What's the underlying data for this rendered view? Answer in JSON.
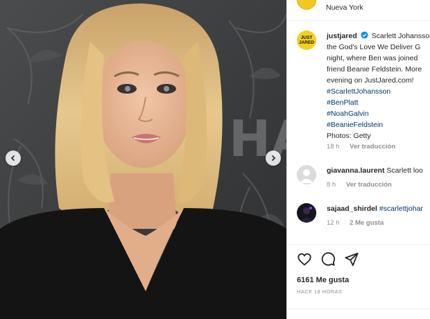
{
  "location": "Nueva York",
  "post": {
    "username": "justjared",
    "avatar_text_top": "JUST",
    "avatar_text_bottom": "JARED",
    "caption_lines": [
      "Scarlett Johansson",
      "the God's Love We Deliver G",
      "night, where Ben was joined",
      "friend Beanie Feldstein. More",
      "evening on JustJared.com!"
    ],
    "hashtags": [
      "#ScarlettJohansson",
      "#BenPlatt",
      "#NoahGalvin",
      "#BeanieFeldstein"
    ],
    "credit": "Photos: Getty",
    "age": "18 h",
    "translate_label": "Ver traducción"
  },
  "comments": [
    {
      "username": "giavanna.laurent",
      "text": "Scarlett loo",
      "age": "8 h",
      "action": "Ver traducción"
    },
    {
      "username": "sajaad_shirdel",
      "text": "#scarlettjohar",
      "age": "12 h",
      "action": "2 Me gusta"
    }
  ],
  "engagement": {
    "likes": "6161 Me gusta",
    "posted": "HACE 18 HORAS"
  },
  "icons": {
    "like": "heart-icon",
    "comment": "comment-icon",
    "share": "share-icon",
    "prev": "chevron-left-icon",
    "next": "chevron-right-icon"
  },
  "colors": {
    "brand_yellow": "#f5cf1f",
    "link": "#00376b",
    "muted": "#8e8e8e"
  }
}
